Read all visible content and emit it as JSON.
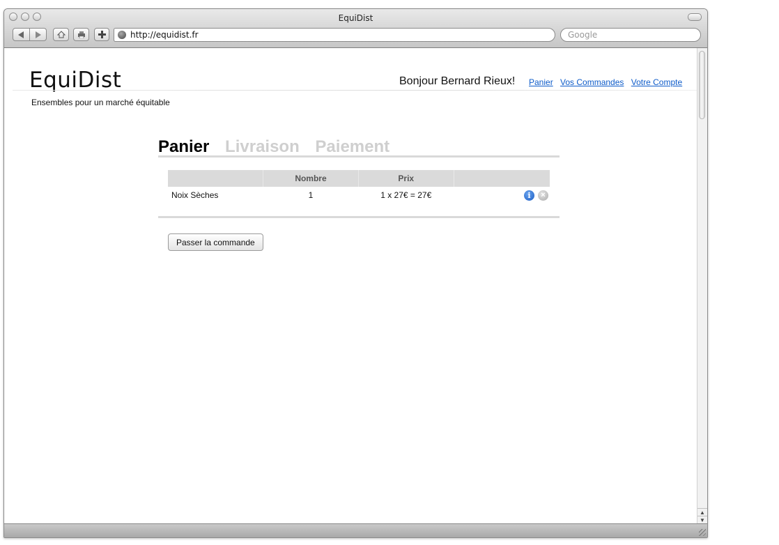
{
  "window": {
    "title": "EquiDist"
  },
  "toolbar": {
    "url": "http://equidist.fr",
    "search_placeholder": "Google"
  },
  "site": {
    "logo": "EquiDist",
    "tagline": "Ensembles pour un marché équitable",
    "greeting": "Bonjour Bernard Rieux!",
    "links": [
      "Panier",
      "Vos Commandes",
      "Votre Compte"
    ]
  },
  "steps": [
    "Panier",
    "Livraison",
    "Paiement"
  ],
  "active_step": "Panier",
  "cart": {
    "columns": [
      "",
      "Nombre",
      "Prix",
      ""
    ],
    "rows": [
      {
        "product": "Noix Sèches",
        "quantity": "1",
        "price": "1 x 27€ = 27€"
      }
    ]
  },
  "order_button": "Passer la commande",
  "colors": {
    "link": "#0d5bc9",
    "inactive_step": "#cfcfcf",
    "info_icon": "#1a5cc3"
  }
}
